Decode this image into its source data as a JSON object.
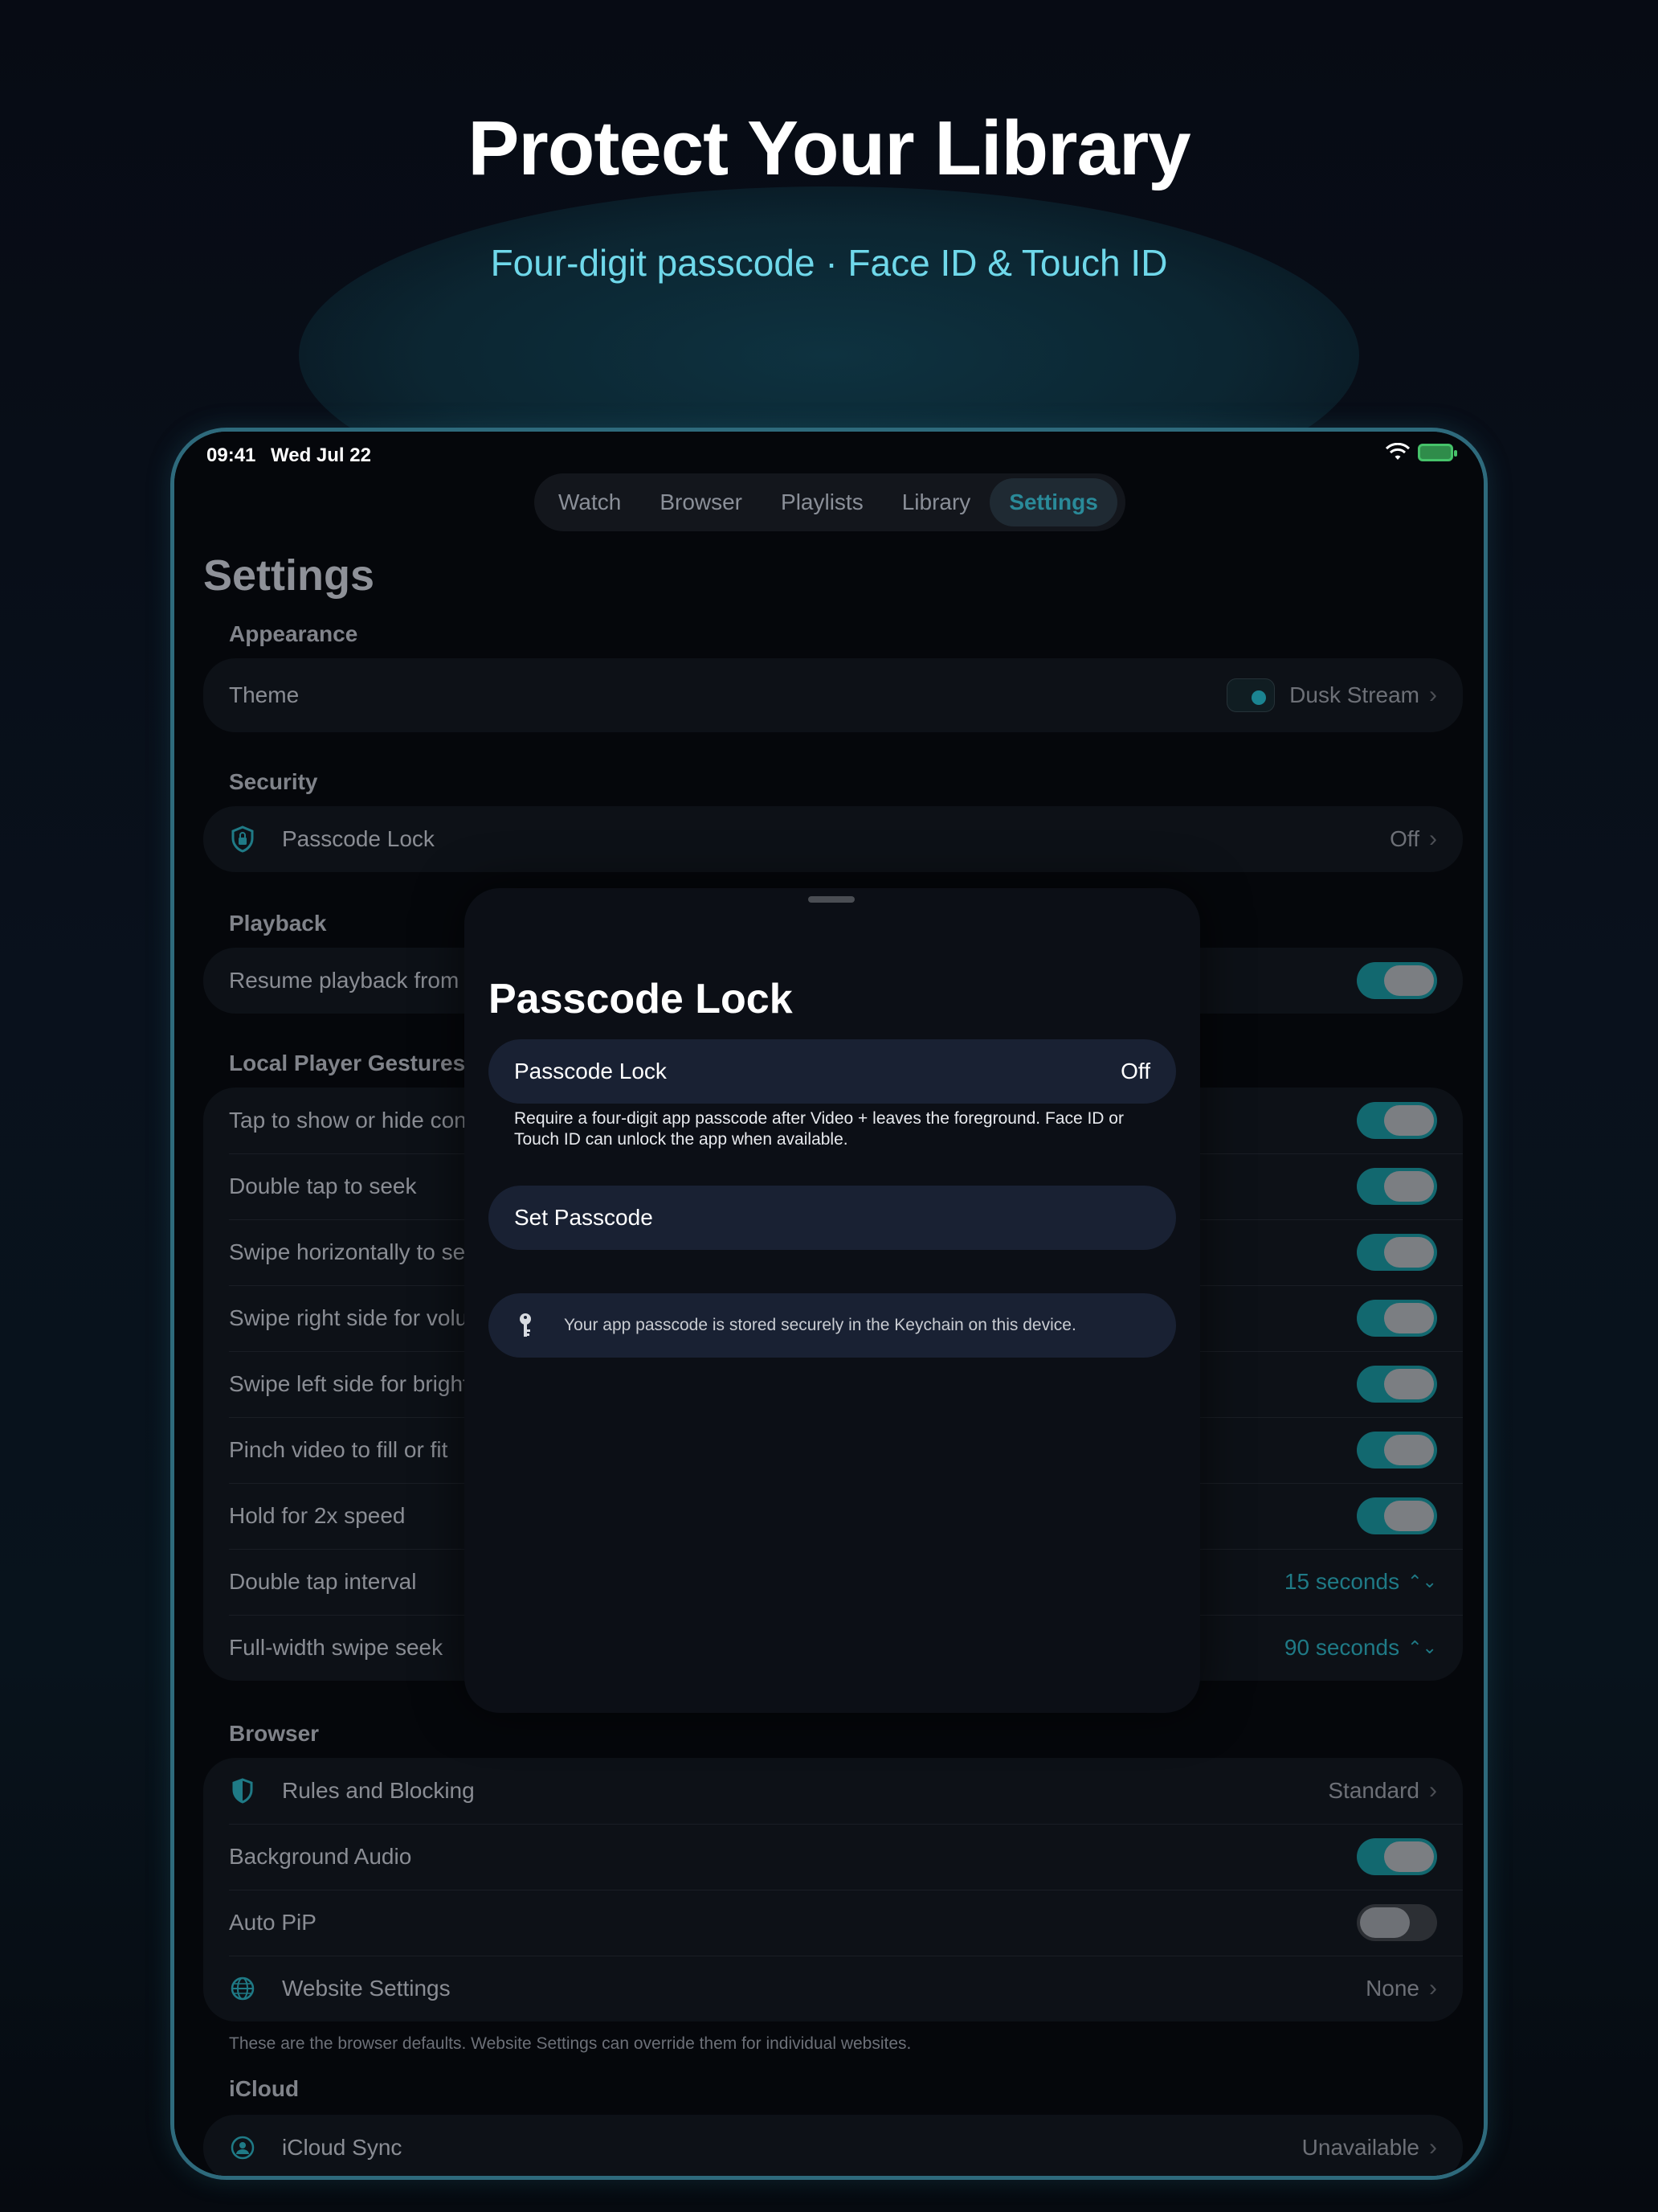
{
  "marketing": {
    "headline": "Protect Your Library",
    "subheadline": "Four-digit passcode · Face ID & Touch ID"
  },
  "status_bar": {
    "time": "09:41",
    "date": "Wed Jul 22"
  },
  "tabs": [
    {
      "label": "Watch"
    },
    {
      "label": "Browser"
    },
    {
      "label": "Playlists"
    },
    {
      "label": "Library"
    },
    {
      "label": "Settings",
      "active": true
    }
  ],
  "settings": {
    "title": "Settings",
    "appearance": {
      "header": "Appearance",
      "theme_label": "Theme",
      "theme_value": "Dusk Stream"
    },
    "security": {
      "header": "Security",
      "passcode_label": "Passcode Lock",
      "passcode_value": "Off"
    },
    "playback": {
      "header": "Playback",
      "resume_label": "Resume playback from la",
      "resume_on": true
    },
    "gestures": {
      "header": "Local Player Gestures",
      "rows": [
        {
          "label": "Tap to show or hide cont",
          "on": true
        },
        {
          "label": "Double tap to seek",
          "on": true
        },
        {
          "label": "Swipe horizontally to see",
          "on": true
        },
        {
          "label": "Swipe right side for volur",
          "on": true
        },
        {
          "label": "Swipe left side for bright",
          "on": true
        },
        {
          "label": "Pinch video to fill or fit",
          "on": true
        },
        {
          "label": "Hold for 2x speed",
          "on": true
        }
      ],
      "double_tap_interval_label": "Double tap interval",
      "double_tap_interval_value": "15 seconds",
      "full_width_swipe_label": "Full-width swipe seek",
      "full_width_swipe_value": "90 seconds"
    },
    "browser": {
      "header": "Browser",
      "rules_label": "Rules and Blocking",
      "rules_value": "Standard",
      "background_audio_label": "Background Audio",
      "background_audio_on": true,
      "auto_pip_label": "Auto PiP",
      "auto_pip_on": false,
      "website_settings_label": "Website Settings",
      "website_settings_value": "None",
      "footnote": "These are the browser defaults. Website Settings can override them for individual websites."
    },
    "icloud": {
      "header": "iCloud",
      "sync_label": "iCloud Sync",
      "sync_value": "Unavailable"
    }
  },
  "sheet": {
    "title": "Passcode Lock",
    "passcode_row_label": "Passcode Lock",
    "passcode_row_value": "Off",
    "description": "Require a four-digit app passcode after Video + leaves the foreground. Face ID or Touch ID can unlock the app when available.",
    "set_passcode_label": "Set Passcode",
    "info_text": "Your app passcode is stored securely in the Keychain on this device."
  },
  "colors": {
    "accent_teal": "#1f7a86",
    "subheadline": "#6fd8ea",
    "toggle_on": "#12686f",
    "device_border": "#2e6a7c"
  },
  "icons": {
    "security": "shield-lock-icon",
    "rules": "shield-half-icon",
    "website": "globe-icon",
    "icloud": "icloud-person-icon",
    "info": "key-icon"
  }
}
